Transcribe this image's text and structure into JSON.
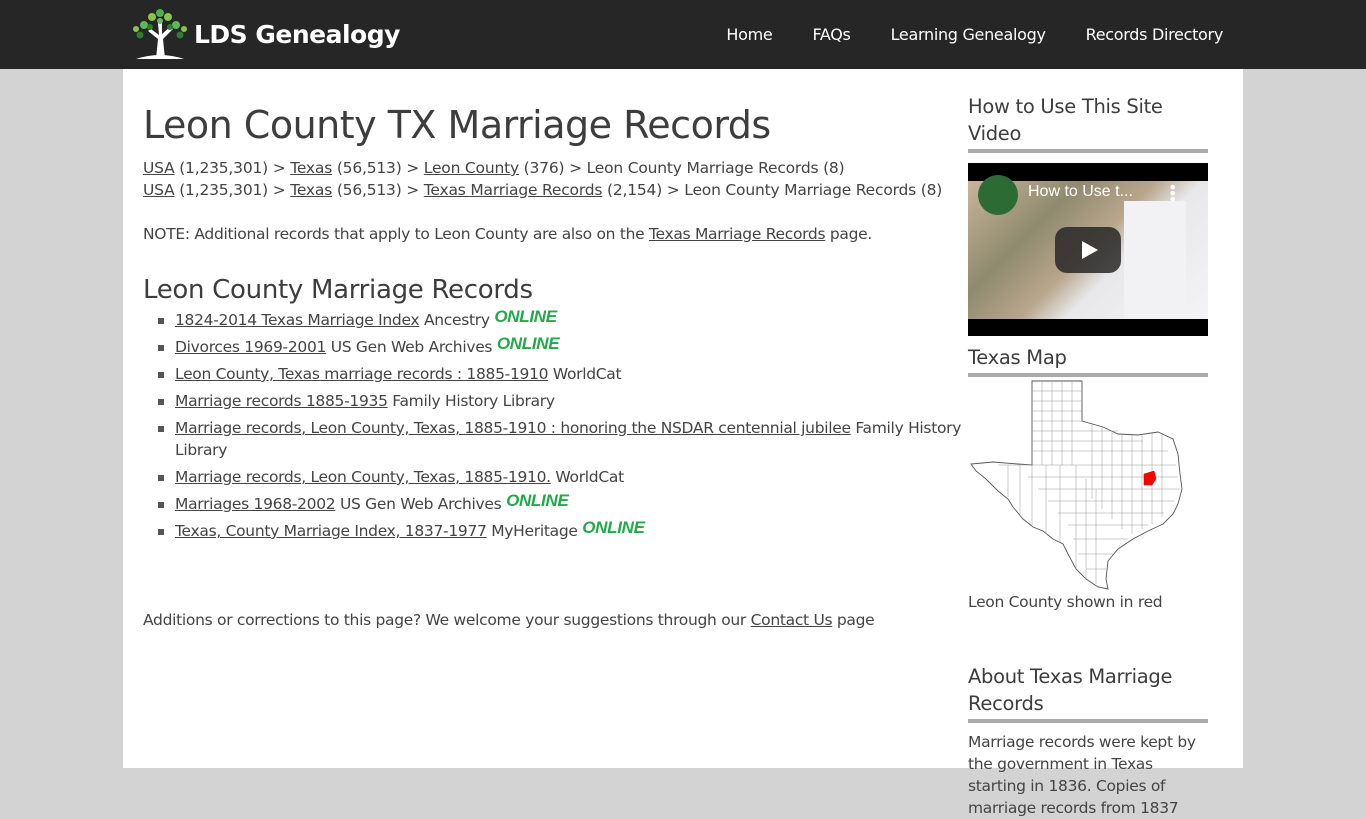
{
  "site": {
    "name": "LDS Genealogy",
    "logo_icon": "tree-icon"
  },
  "nav": {
    "items": [
      {
        "label": "Home"
      },
      {
        "label": "FAQs"
      },
      {
        "label": "Learning Genealogy"
      },
      {
        "label": "Records Directory"
      }
    ]
  },
  "main": {
    "title": "Leon County TX Marriage Records",
    "breadcrumbs": [
      {
        "usa": "USA",
        "usa_count": " (1,235,301) > ",
        "state": "Texas",
        "state_count": " (56,513) > ",
        "mid": "Leon County",
        "mid_count": " (376) > ",
        "current": "Leon County Marriage Records (8)"
      },
      {
        "usa": "USA",
        "usa_count": " (1,235,301) > ",
        "state": "Texas",
        "state_count": " (56,513) > ",
        "mid": "Texas Marriage Records",
        "mid_count": " (2,154) > ",
        "current": "Leon County Marriage Records (8)"
      }
    ],
    "note": {
      "prefix": "NOTE: Additional records that apply to Leon County are also on the ",
      "link": "Texas Marriage Records",
      "suffix": " page."
    },
    "section_title": "Leon County Marriage Records",
    "records": [
      {
        "link": "1824-2014 Texas Marriage Index",
        "source": " Ancestry ",
        "online": "ONLINE"
      },
      {
        "link": "Divorces 1969-2001",
        "source": " US Gen Web Archives ",
        "online": "ONLINE"
      },
      {
        "link": "Leon County, Texas marriage records : 1885-1910",
        "source": " WorldCat",
        "online": ""
      },
      {
        "link": "Marriage records 1885-1935",
        "source": " Family History Library",
        "online": ""
      },
      {
        "link": "Marriage records, Leon County, Texas, 1885-1910 : honoring the NSDAR centennial jubilee",
        "source": " Family History Library",
        "online": ""
      },
      {
        "link": "Marriage records, Leon County, Texas, 1885-1910.",
        "source": " WorldCat",
        "online": ""
      },
      {
        "link": "Marriages 1968-2002",
        "source": " US Gen Web Archives ",
        "online": "ONLINE"
      },
      {
        "link": "Texas, County Marriage Index, 1837-1977",
        "source": " MyHeritage ",
        "online": "ONLINE"
      }
    ],
    "additions": {
      "prefix": "Additions or corrections to this page? We welcome your suggestions through our ",
      "link": "Contact Us",
      "suffix": " page"
    }
  },
  "sidebar": {
    "video_title": "How to Use This Site Video",
    "video_caption": "How to Use t...",
    "map_title": "Texas Map",
    "map_caption": "Leon County shown in red",
    "highlight_color": "#ff0000",
    "about_title": "About Texas Marriage Records",
    "about_text": "Marriage records were kept by the government in Texas starting in 1836. Copies of marriage records from 1837"
  },
  "colors": {
    "navbar": "#262626",
    "online": "#22a94a",
    "background": "#d3d3d3"
  }
}
